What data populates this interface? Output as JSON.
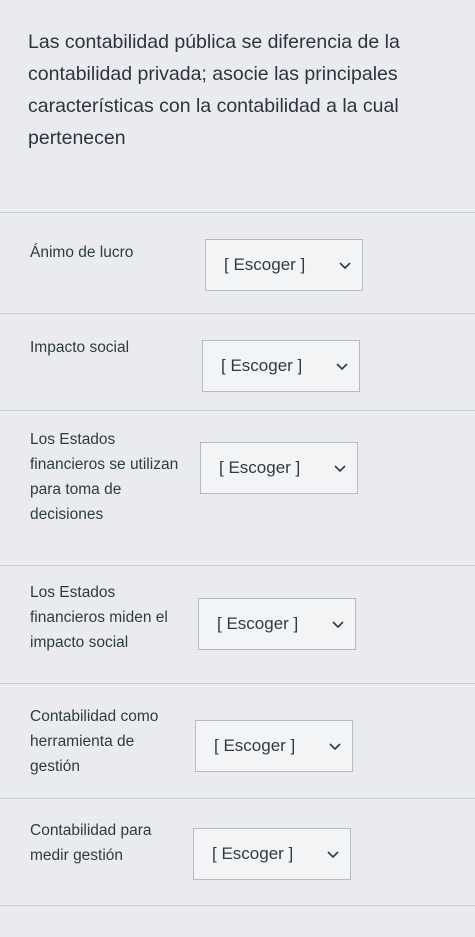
{
  "question": "Las contabilidad pública se diferencia de la contabilidad privada; asocie las principales características con la contabilidad a la cual pertenecen",
  "select_placeholder": "[ Escoger ]",
  "items": [
    {
      "label": "Ánimo de lucro",
      "selected": "[ Escoger ]"
    },
    {
      "label": "Impacto social",
      "selected": "[ Escoger ]"
    },
    {
      "label": "Los Estados financieros se utilizan para toma de decisiones",
      "selected": "[ Escoger ]"
    },
    {
      "label": "Los Estados financieros miden el impacto social",
      "selected": "[ Escoger ]"
    },
    {
      "label": "Contabilidad como herramienta de gestión",
      "selected": "[ Escoger ]"
    },
    {
      "label": "Contabilidad para medir gestión",
      "selected": "[ Escoger ]"
    }
  ],
  "icons": {
    "dropdown": "chevron-down-icon"
  }
}
